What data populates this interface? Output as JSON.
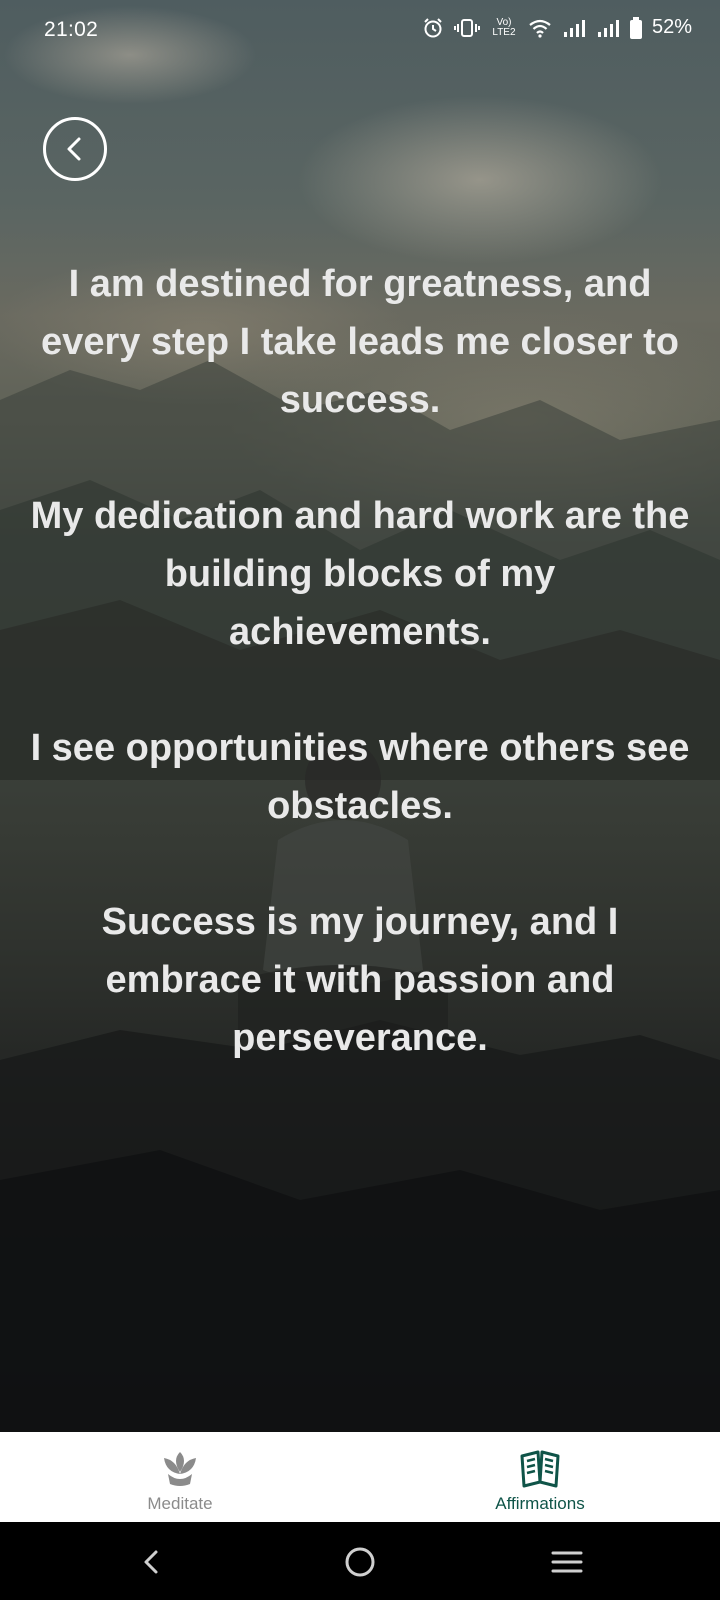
{
  "status_bar": {
    "time": "21:02",
    "battery": "52%",
    "icons": [
      "alarm-icon",
      "vibrate-icon",
      "volte-lte2-icon",
      "wifi-icon",
      "signal-icon",
      "signal-icon",
      "battery-icon"
    ],
    "volte_text": "Vo) LTE2"
  },
  "header": {
    "back_icon": "chevron-left-circle-icon"
  },
  "affirmations": [
    "I am destined for greatness, and every step I take leads me closer to success.",
    "My dedication and hard work are the building blocks of my achievements.",
    "I see opportunities where others see obstacles.",
    "Success is my journey, and I embrace it with passion and perseverance."
  ],
  "bottom_nav": {
    "items": [
      {
        "label": "Meditate",
        "icon": "lotus-flower-icon",
        "active": false
      },
      {
        "label": "Affirmations",
        "icon": "open-book-icon",
        "active": true
      }
    ]
  },
  "system_nav": {
    "icons": [
      "back-nav-icon",
      "home-nav-icon",
      "recents-nav-icon"
    ]
  },
  "colors": {
    "text_light": "#e9e9e9",
    "active_tab": "#0f5448",
    "inactive_tab": "#8b8b8b",
    "nav_background": "#ffffff"
  }
}
